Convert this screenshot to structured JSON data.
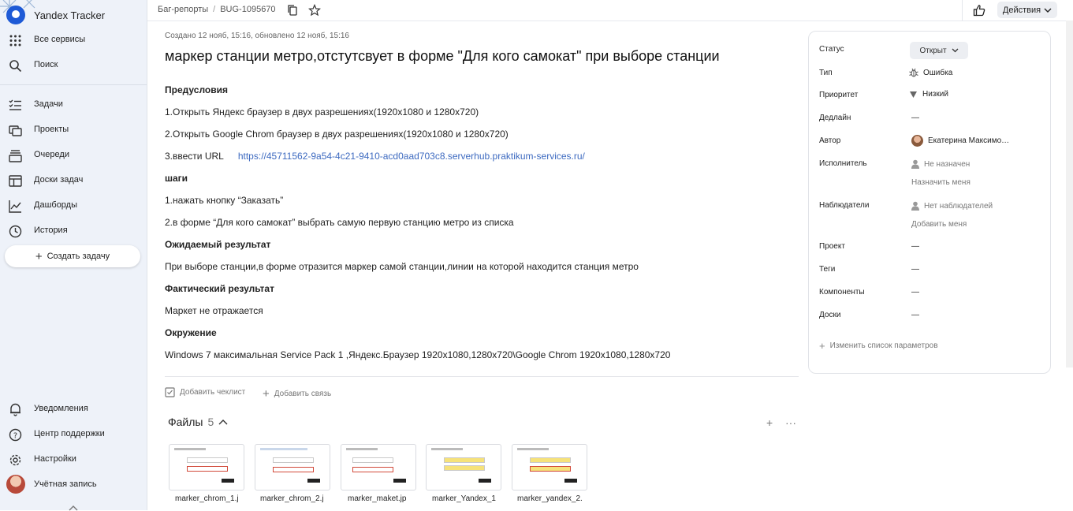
{
  "app": {
    "name": "Yandex Tracker"
  },
  "sidebar": {
    "top": [
      {
        "label": "Все сервисы",
        "icon": "grid-icon"
      },
      {
        "label": "Поиск",
        "icon": "search-icon"
      }
    ],
    "nav": [
      {
        "label": "Задачи",
        "icon": "tasks-icon"
      },
      {
        "label": "Проекты",
        "icon": "projects-icon"
      },
      {
        "label": "Очереди",
        "icon": "queues-icon"
      },
      {
        "label": "Доски задач",
        "icon": "boards-icon"
      },
      {
        "label": "Дашборды",
        "icon": "dashboards-icon"
      },
      {
        "label": "История",
        "icon": "history-icon"
      }
    ],
    "create_label": "Создать задачу",
    "bottom": [
      {
        "label": "Уведомления",
        "icon": "bell-icon"
      },
      {
        "label": "Центр поддержки",
        "icon": "help-icon"
      },
      {
        "label": "Настройки",
        "icon": "gear-icon"
      },
      {
        "label": "Учётная запись",
        "icon": "avatar"
      }
    ]
  },
  "header": {
    "breadcrumb": [
      "Баг-репорты",
      "BUG-1095670"
    ],
    "actions_label": "Действия"
  },
  "issue": {
    "meta": "Создано 12 нояб, 15:16, обновлено 12 нояб, 15:16",
    "title": "маркер станции метро,отстутсвует в форме \"Для кого самокат\" при выборе станции",
    "description": [
      {
        "text": "Предусловия",
        "heading": true
      },
      {
        "text": "1.Открыть Яндекс браузер в двух разрешениях(1920х1080 и 1280х720)"
      },
      {
        "text": "2.Открыть Google Chrom браузер в двух разрешениях(1920х1080 и 1280х720)"
      },
      {
        "text": "3.ввести URL",
        "link": "https://45711562-9a54-4c21-9410-acd0aad703c8.serverhub.praktikum-services.ru/"
      },
      {
        "text": "шаги",
        "heading": true
      },
      {
        "text": "1.нажать кнопку “Заказать”"
      },
      {
        "text": "2.в форме “Для кого самокат” выбрать самую первую станцию метро из списка"
      },
      {
        "text": "Ожидаемый результат",
        "heading": true
      },
      {
        "text": "При выборе станции,в форме отразится маркер самой станции,линии на которой находится станция метро"
      },
      {
        "text": "Фактический результат",
        "heading": true
      },
      {
        "text": "Маркет не отражается"
      },
      {
        "text": "Окружение",
        "heading": true
      },
      {
        "text": "Windows 7 максимальная Service Pack 1 ,Яндекс.Браузер 1920х1080,1280х720\\Google Chrom 1920х1080,1280х720"
      }
    ],
    "add_checklist": "Добавить чеклист",
    "add_link": "Добавить связь",
    "files": {
      "label": "Файлы",
      "count": "5",
      "items": [
        {
          "name": "marker_chrom_1.j"
        },
        {
          "name": "marker_chrom_2.j"
        },
        {
          "name": "marker_maket.jp"
        },
        {
          "name": "marker_Yandex_1"
        },
        {
          "name": "marker_yandex_2."
        }
      ]
    }
  },
  "params": {
    "status": {
      "label": "Статус",
      "value": "Открыт"
    },
    "type": {
      "label": "Тип",
      "value": "Ошибка"
    },
    "priority": {
      "label": "Приоритет",
      "value": "Низкий"
    },
    "deadline": {
      "label": "Дедлайн",
      "value": "—"
    },
    "author": {
      "label": "Автор",
      "value": "Екатерина Максимо…"
    },
    "assignee": {
      "label": "Исполнитель",
      "value": "Не назначен",
      "action": "Назначить меня"
    },
    "followers": {
      "label": "Наблюдатели",
      "value": "Нет наблюдателей",
      "action": "Добавить меня"
    },
    "project": {
      "label": "Проект",
      "value": "—"
    },
    "tags": {
      "label": "Теги",
      "value": "—"
    },
    "components": {
      "label": "Компоненты",
      "value": "—"
    },
    "boards": {
      "label": "Доски",
      "value": "—"
    },
    "edit_label": "Изменить список параметров"
  },
  "colors": {
    "link": "#3d6ac0",
    "brand": "#1e5ad6",
    "sidebar_bg": "#eef2f9"
  }
}
